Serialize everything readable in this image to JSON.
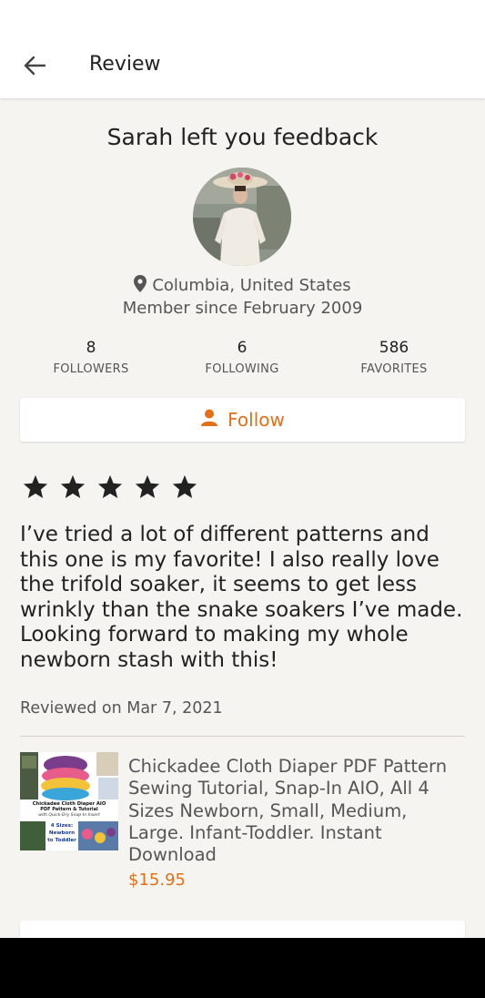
{
  "appbar": {
    "title": "Review"
  },
  "profile": {
    "headline": "Sarah left you feedback",
    "location": "Columbia, United States",
    "member_since": "Member since February 2009",
    "stats": [
      {
        "value": "8",
        "label": "FOLLOWERS"
      },
      {
        "value": "6",
        "label": "FOLLOWING"
      },
      {
        "value": "586",
        "label": "FAVORITES"
      }
    ],
    "follow_label": "Follow"
  },
  "review": {
    "rating": 5,
    "text": "I’ve tried a lot of different patterns and this one is my favorite! I also really love the trifold soaker, it seems to get less wrinkly than the snake soakers I’ve made. Looking forward to making my whole newborn stash with this!",
    "date": "Reviewed on Mar 7, 2021"
  },
  "listing": {
    "title": "Chickadee Cloth Diaper PDF Pattern Sewing Tutorial, Snap-In AIO, All 4 Sizes Newborn, Small, Medium, Large. Infant-Toddler. Instant Download",
    "price": "$15.95",
    "thumb_text": {
      "line1": "Chickadee Cloth Diaper AIO",
      "line2": "PDF Pattern & Tutorial",
      "line3": "with Quick-Dry Snap-In Insert",
      "line4": "4 Sizes:",
      "line5": "Newborn",
      "line6": "to Toddler"
    }
  },
  "colors": {
    "accent": "#e0701a",
    "background": "#f5f4f1"
  }
}
